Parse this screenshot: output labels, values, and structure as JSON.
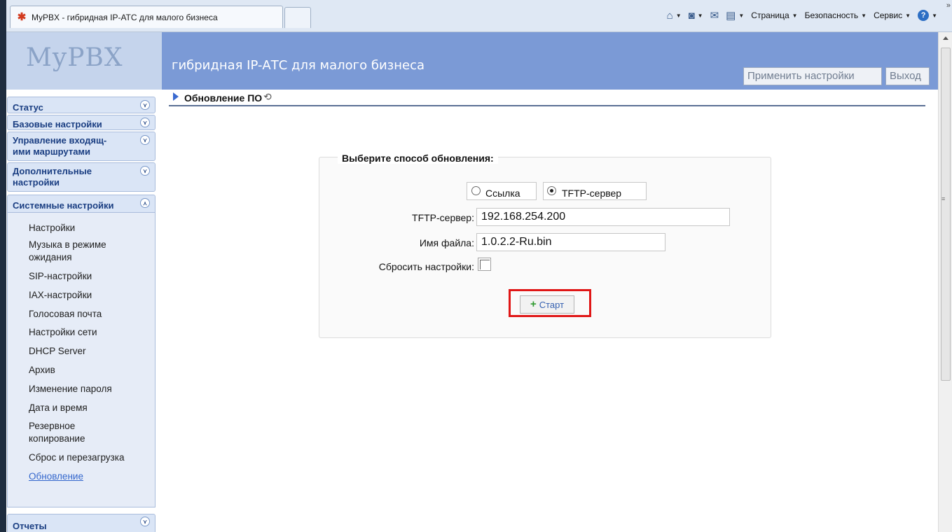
{
  "browser": {
    "tab_title": "MyPBX - гибридная IP-АТС для малого бизнеса",
    "commands": [
      "Страница",
      "Безопасность",
      "Сервис"
    ],
    "overflow": "»"
  },
  "header": {
    "logo": "MyPBX",
    "slogan": "гибридная IP-АТС для малого бизнеса",
    "apply_label": "Применить настройки",
    "exit_label": "Выход"
  },
  "sidebar": {
    "sections": [
      {
        "label": "Статус"
      },
      {
        "label": "Базовые настройки"
      },
      {
        "label": "Управление входящ-ими маршрутами",
        "line1": "Управление входящ-",
        "line2": "ими маршрутами"
      },
      {
        "label": "Дополнительные настройки",
        "line1": "Дополнительные",
        "line2": "настройки"
      },
      {
        "label": "Системные настройки"
      },
      {
        "label": "Отчеты"
      }
    ],
    "items": [
      "Настройки",
      "Музыка в режиме ожидания",
      "SIP-настройки",
      "IAX-настройки",
      "Голосовая почта",
      "Настройки сети",
      "DHCP Server",
      "Архив",
      "Изменение пароля",
      "Дата и время",
      "Резервное копирование",
      "Сброс и перезагрузка",
      "Обновление"
    ],
    "item_lines": {
      "music_1": "Музыка в режиме",
      "music_2": "ожидания",
      "backup_1": "Резервное",
      "backup_2": "копирование"
    },
    "active_item": "Обновление"
  },
  "main": {
    "breadcrumb": "Обновление ПО",
    "panel_title": "Выберите способ обновления:",
    "options": [
      {
        "label": "Ссылка",
        "selected": false
      },
      {
        "label": "TFTP-сервер",
        "selected": true
      }
    ],
    "fields": {
      "tftp_label": "TFTP-сервер:",
      "tftp_value": "192.168.254.200",
      "file_label": "Имя файла:",
      "file_value": "1.0.2.2-Ru.bin",
      "reset_label": "Сбросить настройки:",
      "reset_checked": false
    },
    "start_label": "Старт"
  },
  "colors": {
    "header_bg": "#7b9ad6",
    "logo_bg": "#c5d4ec",
    "sidebar_section_bg": "#dae5f6",
    "section_text": "#1a3e82",
    "highlight": "#e01616"
  }
}
